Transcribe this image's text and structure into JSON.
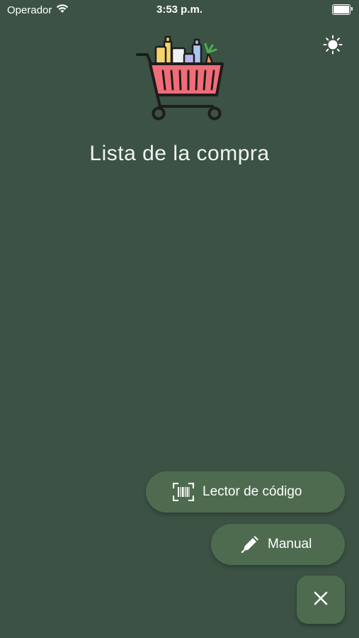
{
  "status_bar": {
    "carrier": "Operador",
    "time": "3:53 p.m."
  },
  "header": {
    "title": "Lista de la compra",
    "logo_icon": "shopping-cart-icon",
    "theme_icon": "sun-icon"
  },
  "actions": {
    "barcode_label": "Lector de código",
    "barcode_icon": "barcode-scan-icon",
    "manual_label": "Manual",
    "manual_icon": "pen-icon",
    "close_icon": "close-icon"
  },
  "colors": {
    "background": "#3b5245",
    "button": "#4e6b4f",
    "cart_basket": "#f06d78"
  }
}
